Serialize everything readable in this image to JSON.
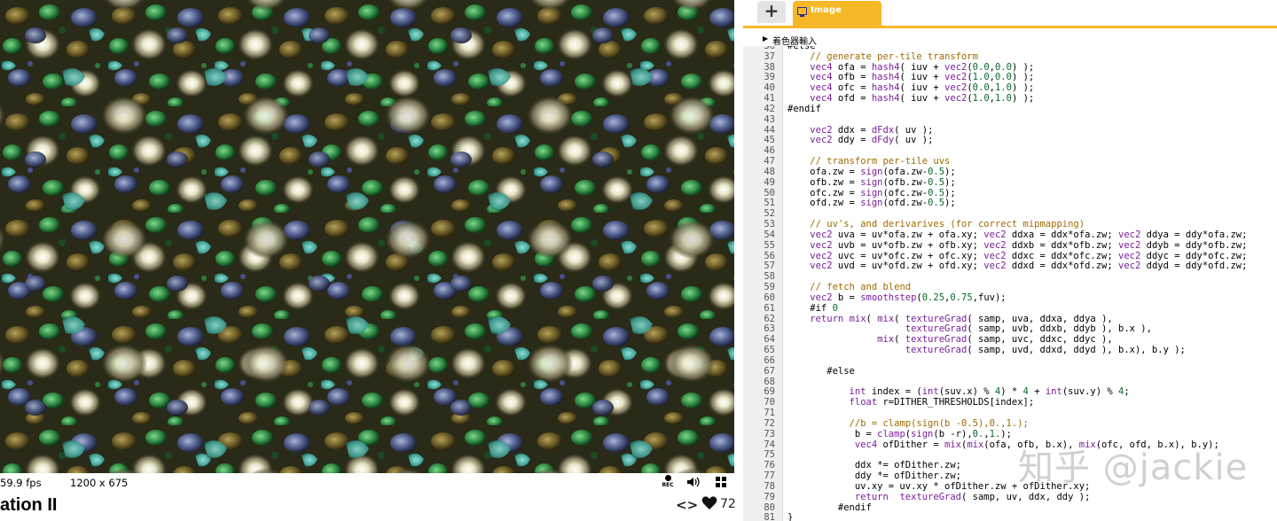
{
  "viewport": {
    "fps_text": "59.9 fps",
    "resolution_text": "1200 x 675",
    "rec_label": "REC",
    "shader_title": "ation II",
    "likes": "72",
    "colors": {
      "background": "#fefefe"
    }
  },
  "editor": {
    "add_tab_label": "+",
    "active_tab_label": "Image",
    "inputs_label": "着色器輸入",
    "accent_color": "#f6b827",
    "code_lines": [
      {
        "n": "36",
        "t": "#else"
      },
      {
        "n": "37",
        "t": "    // generate per-tile transform"
      },
      {
        "n": "38",
        "t": "    vec4 ofa = hash4( iuv + vec2(0.0,0.0) );"
      },
      {
        "n": "39",
        "t": "    vec4 ofb = hash4( iuv + vec2(1.0,0.0) );"
      },
      {
        "n": "40",
        "t": "    vec4 ofc = hash4( iuv + vec2(0.0,1.0) );"
      },
      {
        "n": "41",
        "t": "    vec4 ofd = hash4( iuv + vec2(1.0,1.0) );"
      },
      {
        "n": "42",
        "t": "#endif"
      },
      {
        "n": "43",
        "t": ""
      },
      {
        "n": "44",
        "t": "    vec2 ddx = dFdx( uv );"
      },
      {
        "n": "45",
        "t": "    vec2 ddy = dFdy( uv );"
      },
      {
        "n": "46",
        "t": ""
      },
      {
        "n": "47",
        "t": "    // transform per-tile uvs"
      },
      {
        "n": "48",
        "t": "    ofa.zw = sign(ofa.zw-0.5);"
      },
      {
        "n": "49",
        "t": "    ofb.zw = sign(ofb.zw-0.5);"
      },
      {
        "n": "50",
        "t": "    ofc.zw = sign(ofc.zw-0.5);"
      },
      {
        "n": "51",
        "t": "    ofd.zw = sign(ofd.zw-0.5);"
      },
      {
        "n": "52",
        "t": ""
      },
      {
        "n": "53",
        "t": "    // uv's, and derivarives (for correct mipmapping)"
      },
      {
        "n": "54",
        "t": "    vec2 uva = uv*ofa.zw + ofa.xy; vec2 ddxa = ddx*ofa.zw; vec2 ddya = ddy*ofa.zw;"
      },
      {
        "n": "55",
        "t": "    vec2 uvb = uv*ofb.zw + ofb.xy; vec2 ddxb = ddx*ofb.zw; vec2 ddyb = ddy*ofb.zw;"
      },
      {
        "n": "56",
        "t": "    vec2 uvc = uv*ofc.zw + ofc.xy; vec2 ddxc = ddx*ofc.zw; vec2 ddyc = ddy*ofc.zw;"
      },
      {
        "n": "57",
        "t": "    vec2 uvd = uv*ofd.zw + ofd.xy; vec2 ddxd = ddx*ofd.zw; vec2 ddyd = ddy*ofd.zw;"
      },
      {
        "n": "58",
        "t": ""
      },
      {
        "n": "59",
        "t": "    // fetch and blend"
      },
      {
        "n": "60",
        "t": "    vec2 b = smoothstep(0.25,0.75,fuv);"
      },
      {
        "n": "61",
        "t": "    #if 0"
      },
      {
        "n": "62",
        "t": "    return mix( mix( textureGrad( samp, uva, ddxa, ddya ),"
      },
      {
        "n": "63",
        "t": "                     textureGrad( samp, uvb, ddxb, ddyb ), b.x ),"
      },
      {
        "n": "64",
        "t": "                mix( textureGrad( samp, uvc, ddxc, ddyc ),"
      },
      {
        "n": "65",
        "t": "                     textureGrad( samp, uvd, ddxd, ddyd ), b.x), b.y );"
      },
      {
        "n": "66",
        "t": ""
      },
      {
        "n": "67",
        "t": "       #else"
      },
      {
        "n": "68",
        "t": ""
      },
      {
        "n": "69",
        "t": "           int index = (int(suv.x) % 4) * 4 + int(suv.y) % 4;"
      },
      {
        "n": "70",
        "t": "           float r=DITHER_THRESHOLDS[index];"
      },
      {
        "n": "71",
        "t": ""
      },
      {
        "n": "72",
        "t": "           //b = clamp(sign(b -0.5),0.,1.);"
      },
      {
        "n": "73",
        "t": "            b = clamp(sign(b -r),0.,1.);"
      },
      {
        "n": "74",
        "t": "            vec4 ofDither = mix(mix(ofa, ofb, b.x), mix(ofc, ofd, b.x), b.y);"
      },
      {
        "n": "75",
        "t": ""
      },
      {
        "n": "76",
        "t": "            ddx *= ofDither.zw;"
      },
      {
        "n": "77",
        "t": "            ddy *= ofDither.zw;"
      },
      {
        "n": "78",
        "t": "            uv.xy = uv.xy * ofDither.zw + ofDither.xy;"
      },
      {
        "n": "79",
        "t": "            return  textureGrad( samp, uv, ddx, ddy );"
      },
      {
        "n": "80",
        "t": "         #endif"
      },
      {
        "n": "81",
        "t": "}"
      }
    ]
  },
  "watermark_text": "知乎 @jackie"
}
